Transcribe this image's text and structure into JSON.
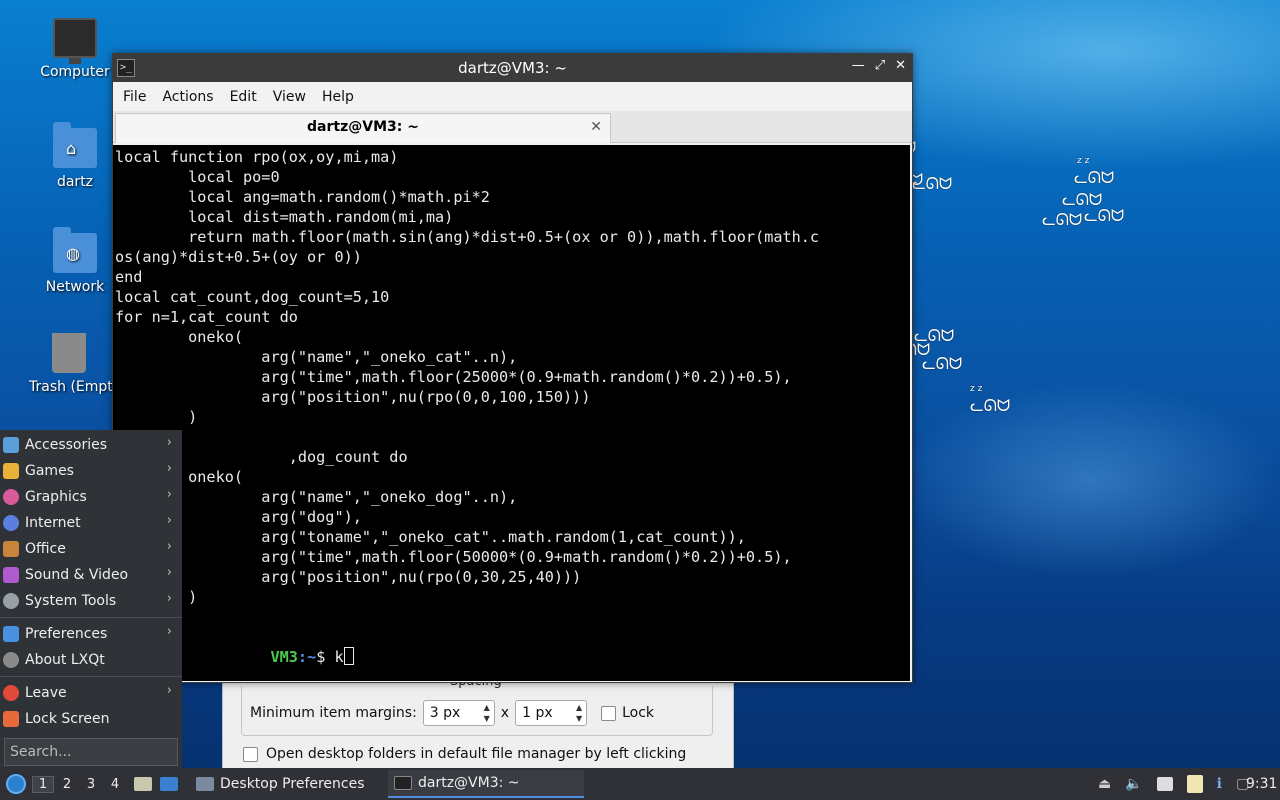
{
  "desktop": {
    "icons": [
      {
        "label": "Computer",
        "type": "computer-icon"
      },
      {
        "label": "dartz",
        "type": "home-folder-icon"
      },
      {
        "label": "Network",
        "type": "network-folder-icon"
      },
      {
        "label": "Trash (Empty)",
        "type": "trash-icon"
      }
    ]
  },
  "terminal": {
    "title": "dartz@VM3: ~",
    "menu": [
      "File",
      "Actions",
      "Edit",
      "View",
      "Help"
    ],
    "tab_label": "dartz@VM3: ~",
    "lines": [
      "local function rpo(ox,oy,mi,ma)",
      "        local po=0",
      "        local ang=math.random()*math.pi*2",
      "        local dist=math.random(mi,ma)",
      "        return math.floor(math.sin(ang)*dist+0.5+(ox or 0)),math.floor(math.c",
      "os(ang)*dist+0.5+(oy or 0))",
      "end",
      "local cat_count,dog_count=5,10",
      "for n=1,cat_count do",
      "        oneko(",
      "                arg(\"name\",\"_oneko_cat\"..n),",
      "                arg(\"time\",math.floor(25000*(0.9+math.random()*0.2))+0.5),",
      "                arg(\"position\",nu(rpo(0,0,100,150)))",
      "        )",
      "",
      "                   ,dog_count do",
      "        oneko(",
      "                arg(\"name\",\"_oneko_dog\"..n),",
      "                arg(\"dog\"),",
      "                arg(\"toname\",\"_oneko_cat\"..math.random(1,cat_count)),",
      "                arg(\"time\",math.floor(50000*(0.9+math.random()*0.2))+0.5),",
      "                arg(\"position\",nu(rpo(0,30,25,40)))",
      "        )",
      "",
      ""
    ],
    "prompt_host": "VM3",
    "prompt_path": ":~",
    "prompt_symbol": "$ ",
    "typed": "k"
  },
  "preferences": {
    "group_label": "Spacing",
    "margins_label": "Minimum item margins:",
    "margin_x": "3 px",
    "times": "x",
    "margin_y": "1 px",
    "lock_label": "Lock",
    "open_folders_label": "Open desktop folders in default file manager by left clicking"
  },
  "app_menu": {
    "items": [
      {
        "label": "Accessories",
        "icon": "accessories-icon",
        "color": "#5aa0d8",
        "submenu": true
      },
      {
        "label": "Games",
        "icon": "games-icon",
        "color": "#e8b23a",
        "submenu": true
      },
      {
        "label": "Graphics",
        "icon": "graphics-icon",
        "color": "#d85a9a",
        "submenu": true
      },
      {
        "label": "Internet",
        "icon": "internet-icon",
        "color": "#5a7fe0",
        "submenu": true
      },
      {
        "label": "Office",
        "icon": "office-icon",
        "color": "#c8843a",
        "submenu": true
      },
      {
        "label": "Sound & Video",
        "icon": "sound-video-icon",
        "color": "#b05ad0",
        "submenu": true
      },
      {
        "label": "System Tools",
        "icon": "system-tools-icon",
        "color": "#9aa0a8",
        "submenu": true
      }
    ],
    "items2": [
      {
        "label": "Preferences",
        "icon": "preferences-icon",
        "color": "#4a90e0",
        "submenu": true
      },
      {
        "label": "About LXQt",
        "icon": "about-icon",
        "color": "#8a8a8a",
        "submenu": false
      }
    ],
    "items3": [
      {
        "label": "Leave",
        "icon": "leave-icon",
        "color": "#e04a3a",
        "submenu": true
      },
      {
        "label": "Lock Screen",
        "icon": "lock-screen-icon",
        "color": "#e86a3a",
        "submenu": false
      }
    ],
    "search_placeholder": "Search..."
  },
  "taskbar": {
    "desktops": [
      "1",
      "2",
      "3",
      "4"
    ],
    "tasks": [
      {
        "label": "Desktop Preferences",
        "icon": "desktop-preferences-icon"
      },
      {
        "label": "dartz@VM3: ~",
        "icon": "terminal-icon"
      }
    ],
    "clock": "9:31"
  }
}
